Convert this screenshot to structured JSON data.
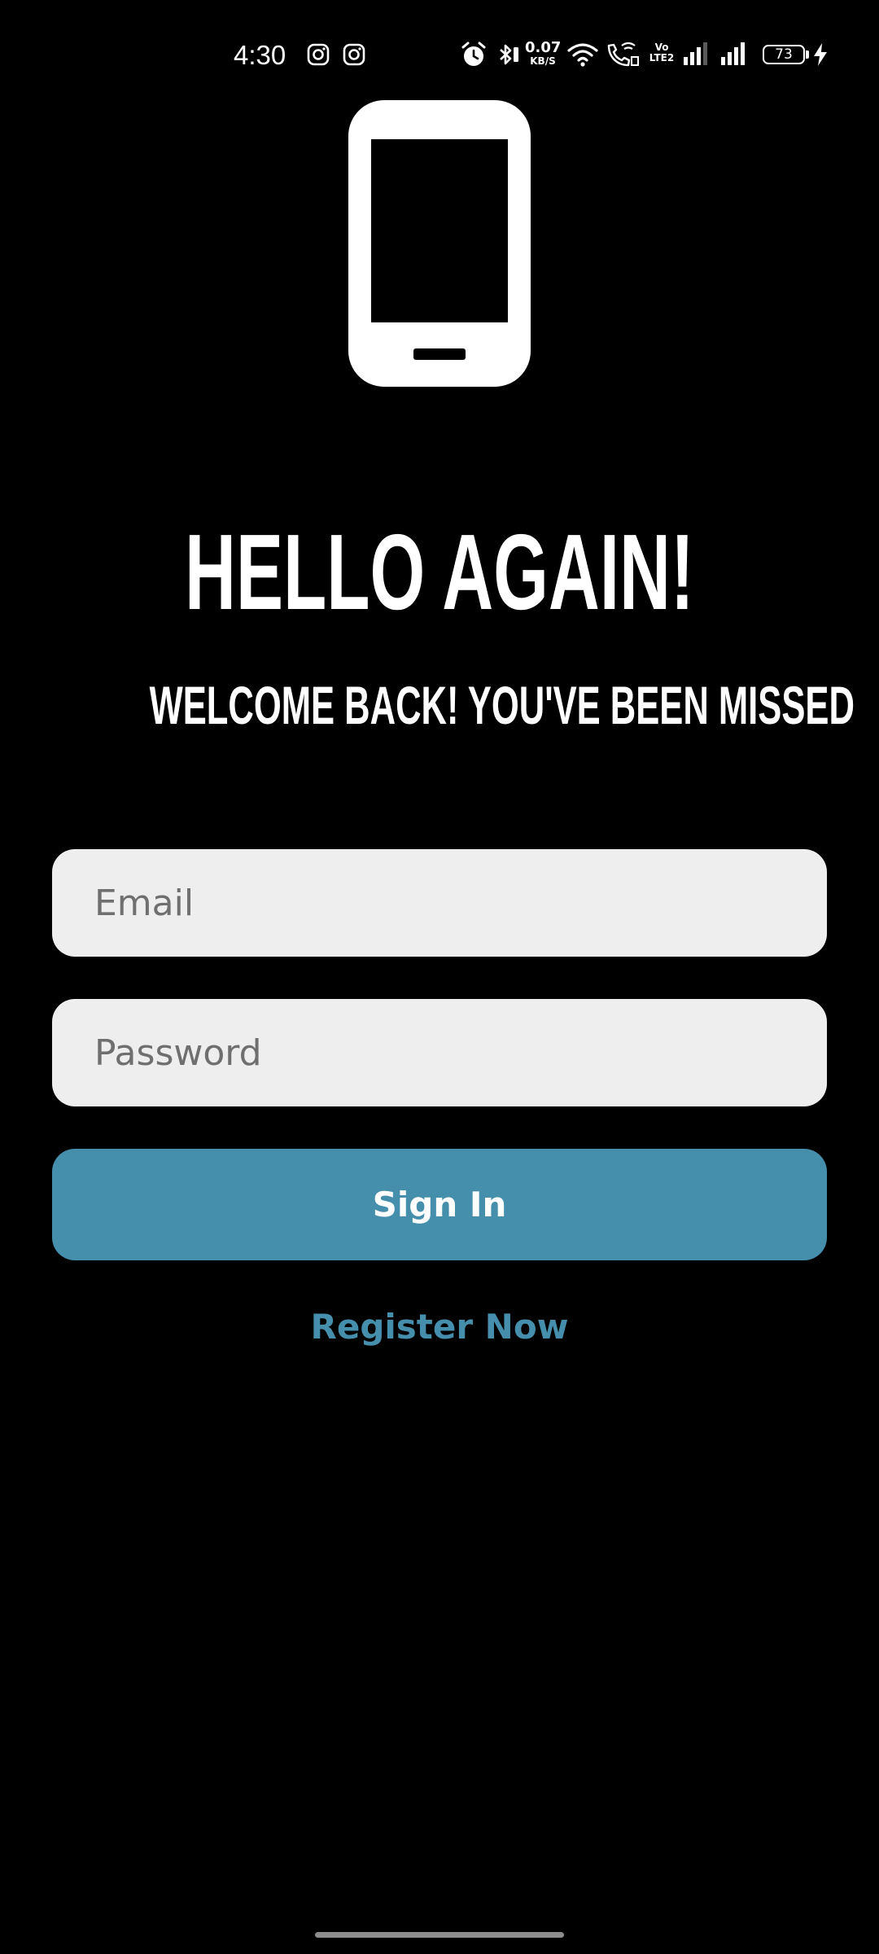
{
  "status_bar": {
    "time": "4:30",
    "notification_icons": [
      "instagram-icon",
      "instagram-icon"
    ],
    "system_icons": [
      "alarm-icon",
      "bluetooth-icon",
      "wifi-icon",
      "wifi-calling-icon",
      "volte-icon",
      "signal-icon",
      "signal-icon",
      "battery-icon",
      "charging-icon"
    ],
    "net_speed_value": "0.07",
    "net_speed_unit": "KB/S",
    "volte_top": "Vo",
    "volte_bottom": "LTE2",
    "battery_level": "73"
  },
  "hero": {
    "icon": "smartphone-icon"
  },
  "heading": {
    "title": "HELLO AGAIN!",
    "subtitle": "WELCOME BACK! YOU'VE BEEN MISSED"
  },
  "form": {
    "email_placeholder": "Email",
    "email_value": "",
    "password_placeholder": "Password",
    "password_value": "",
    "signin_label": "Sign In",
    "register_label": "Register Now"
  },
  "colors": {
    "background": "#000000",
    "field_background": "#eeeeee",
    "accent": "#468fac",
    "text": "#ffffff"
  }
}
